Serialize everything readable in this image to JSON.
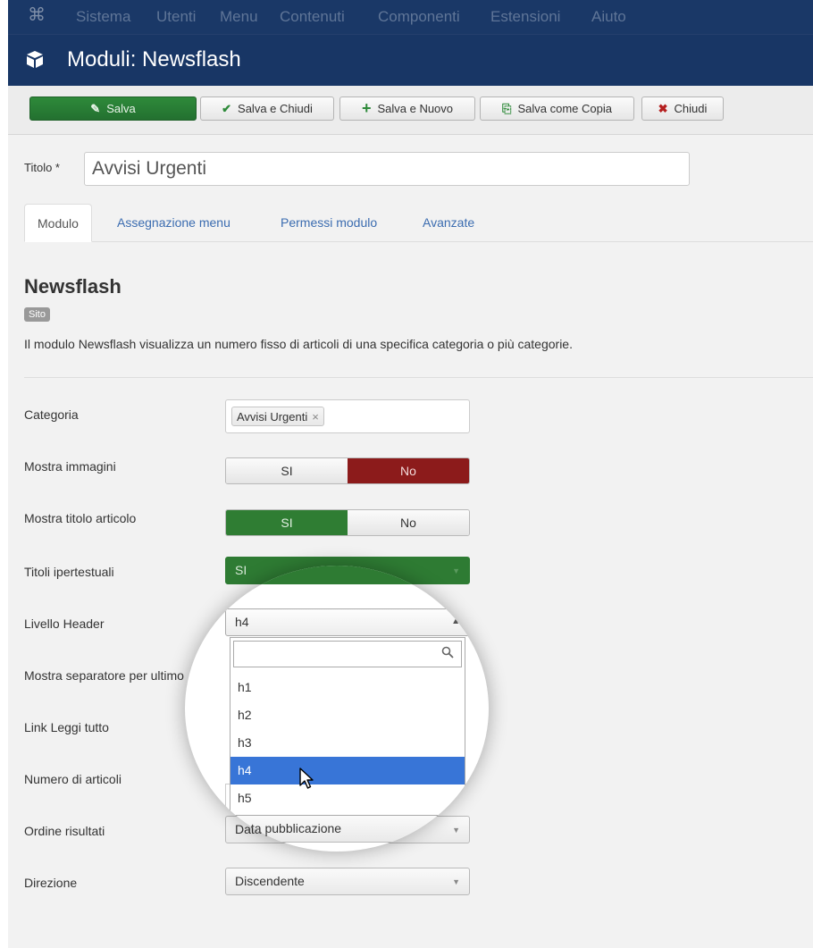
{
  "menubar": {
    "items": [
      "Sistema",
      "Utenti",
      "Menu",
      "Contenuti",
      "Componenti",
      "Estensioni",
      "Aiuto"
    ]
  },
  "page": {
    "title": "Moduli: Newsflash"
  },
  "toolbar": {
    "save": "Salva",
    "save_close": "Salva e Chiudi",
    "save_new": "Salva e Nuovo",
    "save_copy": "Salva come Copia",
    "close": "Chiudi"
  },
  "title_field": {
    "label": "Titolo *",
    "value": "Avvisi Urgenti"
  },
  "tabs": [
    "Modulo",
    "Assegnazione menu",
    "Permessi modulo",
    "Avanzate"
  ],
  "module": {
    "heading": "Newsflash",
    "badge": "Sito",
    "description": "Il modulo Newsflash visualizza un numero fisso di articoli di una specifica categoria o più categorie."
  },
  "fields": {
    "categoria": {
      "label": "Categoria",
      "tag": "Avvisi Urgenti",
      "remove": "×"
    },
    "mostra_immagini": {
      "label": "Mostra immagini",
      "yes": "SI",
      "no": "No",
      "selected": "No"
    },
    "mostra_titolo": {
      "label": "Mostra titolo articolo",
      "yes": "SI",
      "no": "No",
      "selected": "SI"
    },
    "titoli_ipertestuali": {
      "label": "Titoli ipertestuali",
      "value": "SI"
    },
    "livello_header": {
      "label": "Livello Header",
      "value": "h4"
    },
    "mostra_separatore": {
      "label": "Mostra separatore per ultimo"
    },
    "link_leggi_tutto": {
      "label": "Link Leggi tutto"
    },
    "numero_articoli": {
      "label": "Numero di articoli"
    },
    "ordine_risultati": {
      "label": "Ordine risultati",
      "value": "Data pubblicazione"
    },
    "direzione": {
      "label": "Direzione",
      "value": "Discendente"
    }
  },
  "dropdown": {
    "search_placeholder": "",
    "options": [
      "h1",
      "h2",
      "h3",
      "h4",
      "h5"
    ],
    "highlighted": "h4"
  },
  "colors": {
    "menubar_bg": "#1a3867",
    "save_green": "#2e8a3a",
    "no_red": "#8c1b1b",
    "highlight_blue": "#3875d7"
  }
}
